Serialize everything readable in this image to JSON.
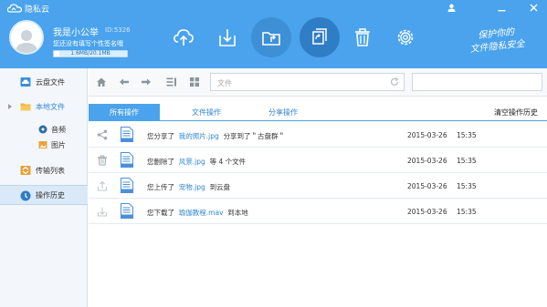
{
  "app": {
    "title": "隐私云"
  },
  "user": {
    "name": "我是小公举",
    "id": "ID:5326",
    "signature": "您还没有填写个性签名哦",
    "storage_text": "1.6MB/20.1MB",
    "storage_fraction": 0.08
  },
  "slogan": {
    "line1": "保护你的",
    "line2": "文件隐私安全"
  },
  "toolbar": {
    "items": [
      {
        "name": "upload"
      },
      {
        "name": "download"
      },
      {
        "name": "share"
      },
      {
        "name": "sync"
      },
      {
        "name": "delete"
      },
      {
        "name": "settings"
      }
    ]
  },
  "window": {
    "user_icon": "user-icon",
    "minimize": "minimize-icon",
    "close": "close-icon"
  },
  "sidebar": {
    "items": [
      {
        "label": "云盘文件"
      },
      {
        "label": "本地文件"
      },
      {
        "label": "音频"
      },
      {
        "label": "图片"
      },
      {
        "label": "传输列表"
      },
      {
        "label": "操作历史"
      }
    ]
  },
  "path": {
    "placeholder": "文件"
  },
  "tabs": [
    {
      "label": "所有操作"
    },
    {
      "label": "文件操作"
    },
    {
      "label": "分享操作"
    }
  ],
  "clear_history": "清空操作历史",
  "history": [
    {
      "action_icon": "share-icon",
      "prefix": "您分享了",
      "file": "我的照片.jpg",
      "suffix": "分享到了＂古盘群＂",
      "date": "2015-03-26",
      "time": "15:35"
    },
    {
      "action_icon": "trash-icon",
      "prefix": "您删除了",
      "file": "风景.jpg",
      "suffix": "等 4 个文件",
      "date": "2015-03-26",
      "time": "15:35"
    },
    {
      "action_icon": "upload-icon",
      "prefix": "您上传了",
      "file": "宠物.jpg",
      "suffix": "到云盘",
      "date": "2015-03-26",
      "time": "15:35"
    },
    {
      "action_icon": "download-icon",
      "prefix": "您下载了",
      "file": "瑜伽教程.mav",
      "suffix": "到本地",
      "date": "2015-03-26",
      "time": "15:35"
    }
  ],
  "colors": {
    "accent": "#4aa3ec",
    "link": "#2f86d4",
    "sidebar_bg": "#f3f7fb"
  }
}
